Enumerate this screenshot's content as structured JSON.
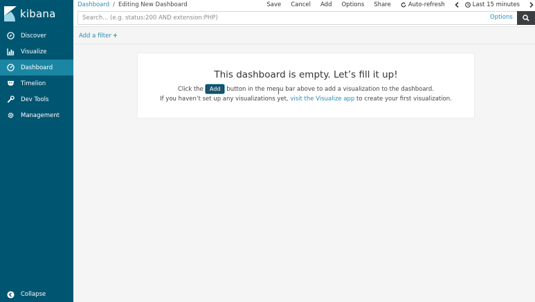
{
  "brand": {
    "name": "kibana"
  },
  "sidebar": {
    "items": [
      {
        "label": "Discover",
        "icon": "compass-icon"
      },
      {
        "label": "Visualize",
        "icon": "bar-chart-icon"
      },
      {
        "label": "Dashboard",
        "icon": "dashboard-icon",
        "active": true
      },
      {
        "label": "Timelion",
        "icon": "timelion-icon"
      },
      {
        "label": "Dev Tools",
        "icon": "wrench-icon"
      },
      {
        "label": "Management",
        "icon": "gear-icon"
      }
    ],
    "collapse_label": "Collapse"
  },
  "breadcrumb": {
    "root": "Dashboard",
    "separator": "/",
    "current": "Editing New Dashboard"
  },
  "menu": {
    "save": "Save",
    "cancel": "Cancel",
    "add": "Add",
    "options": "Options",
    "share": "Share",
    "auto_refresh": "Auto-refresh",
    "time_range": "Last 15 minutes"
  },
  "search": {
    "placeholder": "Search... (e.g. status:200 AND extension:PHP)",
    "options_label": "Options"
  },
  "filter": {
    "add_label": "Add a filter",
    "plus": "+"
  },
  "empty": {
    "title": "This dashboard is empty. Let’s fill it up!",
    "line1_before": "Click the",
    "add_button": "Add",
    "line1_after": "button in the menu bar above to add a visualization to the dashboard.",
    "line2_before": "If you haven’t set up any visualizations yet,",
    "line2_link": "visit the Visualize app",
    "line2_after": "to create your first visualization."
  },
  "colors": {
    "sidebar": "#005571",
    "active": "#1b86a3",
    "link": "#2d8bb2"
  }
}
